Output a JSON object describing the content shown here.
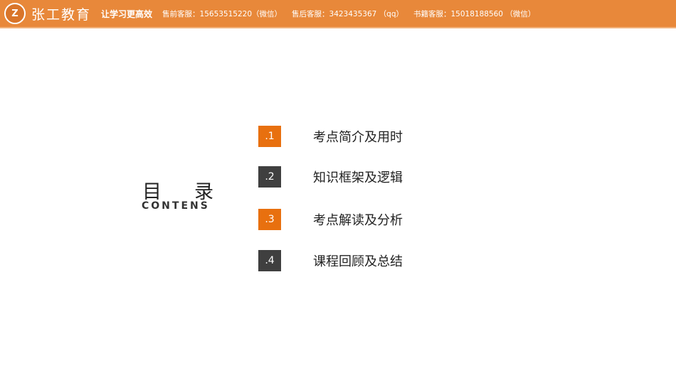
{
  "header": {
    "logo_text": "Z",
    "brand": "张工教育",
    "slogan": "让学习更高效",
    "contacts": [
      "售前客服：15653515220（微信）",
      "售后客服：3423435367 （qq）",
      "书籍客服：15018188560 （微信）"
    ]
  },
  "title": {
    "zh": [
      "目",
      "录"
    ],
    "en": "CONTENS"
  },
  "items": [
    {
      "num": ".1",
      "label": "考点简介及用时",
      "color": "#E8700F"
    },
    {
      "num": ".2",
      "label": "知识框架及逻辑",
      "color": "#3F3F3F"
    },
    {
      "num": ".3",
      "label": "考点解读及分析",
      "color": "#E8700F"
    },
    {
      "num": ".4",
      "label": "课程回顾及总结",
      "color": "#3F3F3F"
    }
  ]
}
